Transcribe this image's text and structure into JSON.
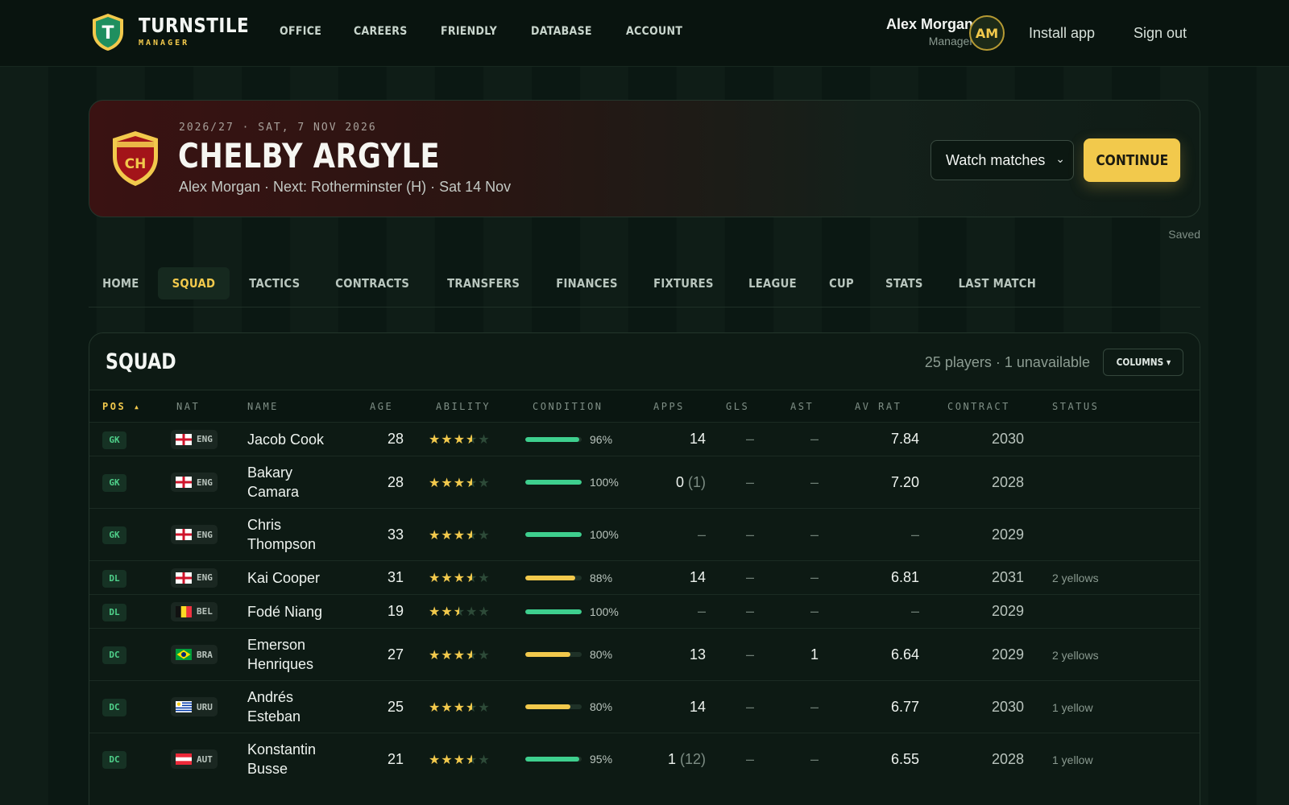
{
  "brand": {
    "title": "TURNSTILE",
    "subtitle": "MANAGER",
    "crest_letter": "T"
  },
  "topnav": [
    "OFFICE",
    "CAREERS",
    "FRIENDLY",
    "DATABASE",
    "ACCOUNT"
  ],
  "user": {
    "name": "Alex Morgan",
    "role": "Manager",
    "initials": "AM",
    "install_label": "Install app",
    "signout_label": "Sign out"
  },
  "club": {
    "crest_letters": "CH",
    "meta": "2026/27 · SAT, 7 NOV 2026",
    "name": "CHELBY ARGYLE",
    "subline": "Alex Morgan · Next: Rotherminster (H) · Sat 14 Nov",
    "watch_selected": "Watch matches",
    "continue_label": "CONTINUE",
    "saved_label": "Saved"
  },
  "tabs": [
    {
      "label": "HOME",
      "active": false
    },
    {
      "label": "SQUAD",
      "active": true
    },
    {
      "label": "TACTICS",
      "active": false
    },
    {
      "label": "CONTRACTS",
      "active": false
    },
    {
      "label": "TRANSFERS",
      "active": false
    },
    {
      "label": "FINANCES",
      "active": false
    },
    {
      "label": "FIXTURES",
      "active": false
    },
    {
      "label": "LEAGUE",
      "active": false
    },
    {
      "label": "CUP",
      "active": false
    },
    {
      "label": "STATS",
      "active": false
    },
    {
      "label": "LAST MATCH",
      "active": false
    }
  ],
  "squad": {
    "title": "SQUAD",
    "count_text": "25 players · 1 unavailable",
    "columns_label": "COLUMNS ▾",
    "headers": [
      "POS ▴",
      "NAT",
      "NAME",
      "AGE",
      "ABILITY",
      "CONDITION",
      "APPS",
      "GLS",
      "AST",
      "AV RAT",
      "CONTRACT",
      "STATUS"
    ],
    "rows": [
      {
        "pos": "GK",
        "nat": "ENG",
        "name": "Jacob Cook",
        "age": "28",
        "stars": 3.5,
        "condition": 96,
        "cond_text": "96%",
        "apps": "14",
        "apps_sub": "",
        "gls": "–",
        "ast": "–",
        "avrat": "7.84",
        "contract": "2030",
        "status": ""
      },
      {
        "pos": "GK",
        "nat": "ENG",
        "name": "Bakary Camara",
        "age": "28",
        "stars": 3.5,
        "condition": 100,
        "cond_text": "100%",
        "apps": "0",
        "apps_sub": "(1)",
        "gls": "–",
        "ast": "–",
        "avrat": "7.20",
        "contract": "2028",
        "status": ""
      },
      {
        "pos": "GK",
        "nat": "ENG",
        "name": "Chris Thompson",
        "age": "33",
        "stars": 3.5,
        "condition": 100,
        "cond_text": "100%",
        "apps": "–",
        "apps_sub": "",
        "gls": "–",
        "ast": "–",
        "avrat": "–",
        "contract": "2029",
        "status": ""
      },
      {
        "pos": "DL",
        "nat": "ENG",
        "name": "Kai Cooper",
        "age": "31",
        "stars": 3.5,
        "condition": 88,
        "cond_text": "88%",
        "apps": "14",
        "apps_sub": "",
        "gls": "–",
        "ast": "–",
        "avrat": "6.81",
        "contract": "2031",
        "status": "2 yellows"
      },
      {
        "pos": "DL",
        "nat": "BEL",
        "name": "Fodé Niang",
        "age": "19",
        "stars": 2.5,
        "condition": 100,
        "cond_text": "100%",
        "apps": "–",
        "apps_sub": "",
        "gls": "–",
        "ast": "–",
        "avrat": "–",
        "contract": "2029",
        "status": ""
      },
      {
        "pos": "DC",
        "nat": "BRA",
        "name": "Emerson Henriques",
        "age": "27",
        "stars": 3.5,
        "condition": 80,
        "cond_text": "80%",
        "apps": "13",
        "apps_sub": "",
        "gls": "–",
        "ast": "1",
        "avrat": "6.64",
        "contract": "2029",
        "status": "2 yellows"
      },
      {
        "pos": "DC",
        "nat": "URU",
        "name": "Andrés Esteban",
        "age": "25",
        "stars": 3.5,
        "condition": 80,
        "cond_text": "80%",
        "apps": "14",
        "apps_sub": "",
        "gls": "–",
        "ast": "–",
        "avrat": "6.77",
        "contract": "2030",
        "status": "1 yellow"
      },
      {
        "pos": "DC",
        "nat": "AUT",
        "name": "Konstantin Busse",
        "age": "21",
        "stars": 3.5,
        "condition": 95,
        "cond_text": "95%",
        "apps": "1",
        "apps_sub": "(12)",
        "gls": "–",
        "ast": "–",
        "avrat": "6.55",
        "contract": "2028",
        "status": "1 yellow"
      }
    ]
  },
  "colors": {
    "accent": "#f2c94c",
    "good": "#3ecf8e",
    "warn": "#f2c94c",
    "club_red": "#a31419"
  }
}
